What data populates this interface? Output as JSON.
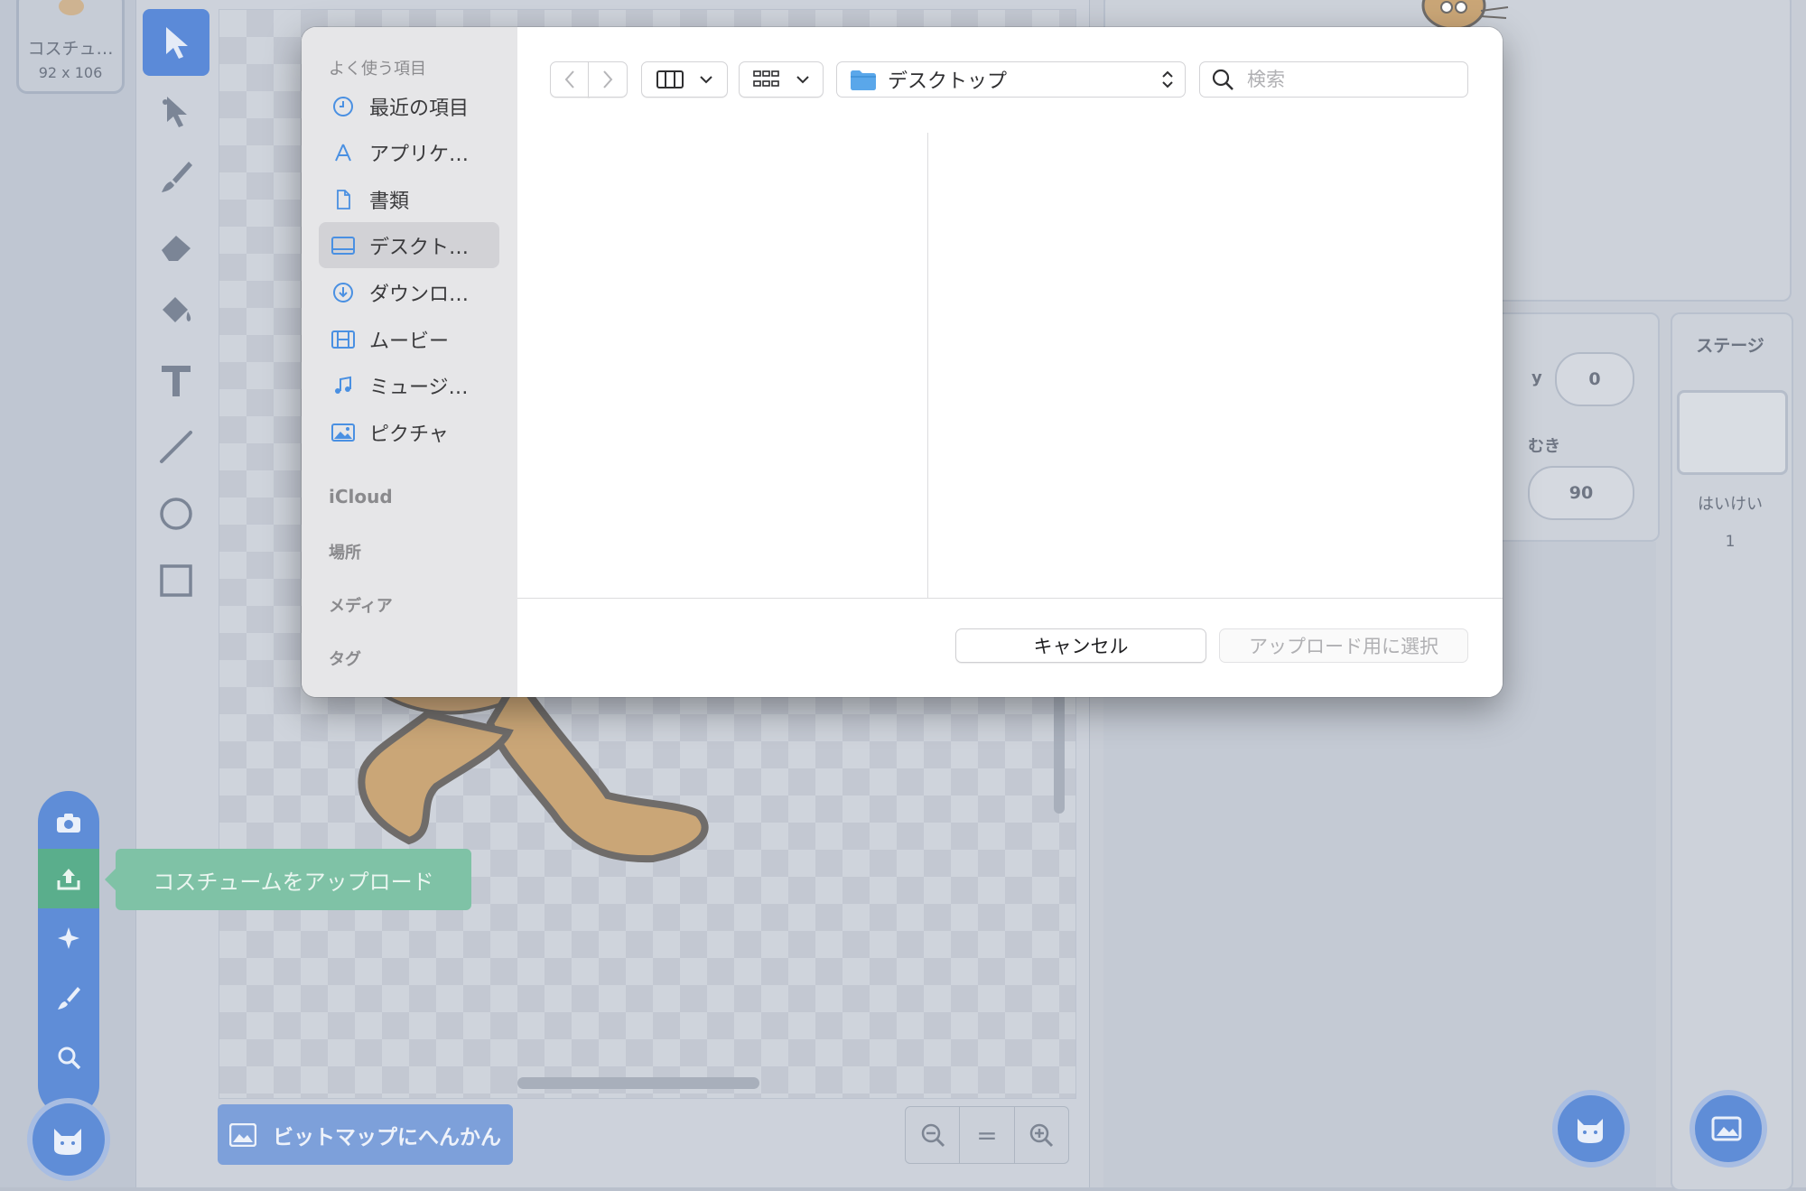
{
  "background": {
    "costume": {
      "name": "コスチュ…",
      "size": "92 x 106"
    },
    "convert_button": "ビットマップにへんかん",
    "tooltip": "コスチュームをアップロード",
    "zoom": {
      "equals": "="
    },
    "sprite_info": {
      "y_label": "y",
      "y_value": "0",
      "direction_label": "むき",
      "direction_value": "90"
    },
    "stage": {
      "title": "ステージ",
      "backdrop_label": "はいけい",
      "backdrop_count": "1"
    }
  },
  "dialog": {
    "sidebar": {
      "favorites_heading": "よく使う項目",
      "items": [
        {
          "label": "最近の項目",
          "icon": "clock-icon"
        },
        {
          "label": "アプリケ…",
          "icon": "applications-icon"
        },
        {
          "label": "書類",
          "icon": "document-icon"
        },
        {
          "label": "デスクト…",
          "icon": "desktop-icon",
          "active": true
        },
        {
          "label": "ダウンロ…",
          "icon": "download-icon"
        },
        {
          "label": "ムービー",
          "icon": "film-icon"
        },
        {
          "label": "ミュージ…",
          "icon": "music-icon"
        },
        {
          "label": "ピクチャ",
          "icon": "picture-icon"
        }
      ],
      "sections": [
        "iCloud",
        "場所",
        "メディア",
        "タグ"
      ]
    },
    "toolbar": {
      "location": "デスクトップ",
      "search_placeholder": "検索"
    },
    "buttons": {
      "cancel": "キャンセル",
      "confirm": "アップロード用に選択"
    },
    "colors": {
      "accent": "#4a90e2",
      "folder": "#5aa7ea"
    }
  }
}
